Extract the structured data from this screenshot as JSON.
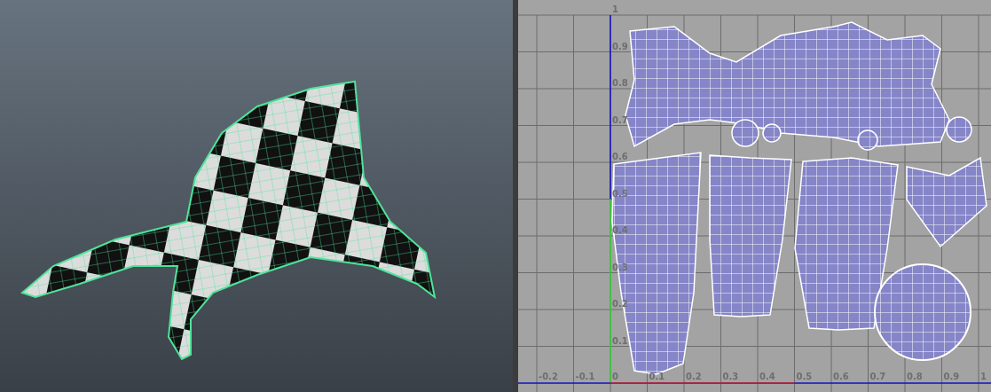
{
  "uv_editor": {
    "v_axis_labels": [
      "1",
      "0.9",
      "0.8",
      "0.7",
      "0.6",
      "0.5",
      "0.4",
      "0.3",
      "0.2",
      "0.1"
    ],
    "u_axis_labels": [
      "-0.2",
      "-0.1",
      "0",
      "0.1",
      "0.2",
      "0.3",
      "0.4",
      "0.5",
      "0.6",
      "0.7",
      "0.8",
      "0.9",
      "1"
    ]
  }
}
